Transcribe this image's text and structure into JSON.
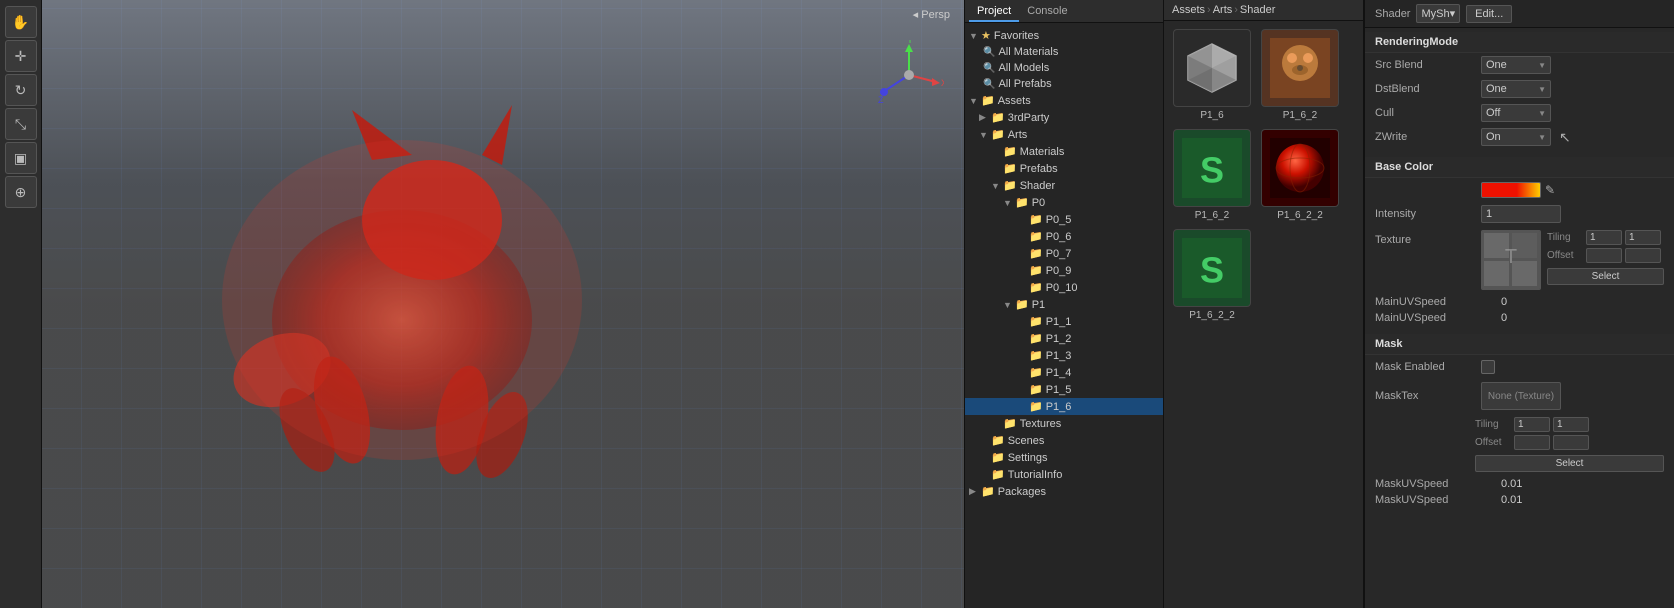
{
  "toolbar": {
    "buttons": [
      {
        "id": "hand",
        "icon": "✋",
        "active": false
      },
      {
        "id": "move",
        "icon": "✛",
        "active": false
      },
      {
        "id": "rotate",
        "icon": "↻",
        "active": false
      },
      {
        "id": "scale",
        "icon": "⤡",
        "active": false
      },
      {
        "id": "rect",
        "icon": "▣",
        "active": false
      },
      {
        "id": "gizmo",
        "icon": "⊕",
        "active": false
      }
    ]
  },
  "viewport": {
    "label": "◂ Persp"
  },
  "project": {
    "tabs": [
      "Project",
      "Console"
    ],
    "activeTab": "Project",
    "tree": [
      {
        "id": "favorites",
        "label": "Favorites",
        "indent": 0,
        "expanded": true,
        "type": "folder"
      },
      {
        "id": "all-materials",
        "label": "All Materials",
        "indent": 1,
        "type": "search"
      },
      {
        "id": "all-models",
        "label": "All Models",
        "indent": 1,
        "type": "search"
      },
      {
        "id": "all-prefabs",
        "label": "All Prefabs",
        "indent": 1,
        "type": "search"
      },
      {
        "id": "assets",
        "label": "Assets",
        "indent": 0,
        "expanded": true,
        "type": "folder"
      },
      {
        "id": "3rdparty",
        "label": "3rdParty",
        "indent": 1,
        "type": "folder"
      },
      {
        "id": "arts",
        "label": "Arts",
        "indent": 1,
        "expanded": true,
        "type": "folder"
      },
      {
        "id": "materials",
        "label": "Materials",
        "indent": 2,
        "type": "folder"
      },
      {
        "id": "prefabs",
        "label": "Prefabs",
        "indent": 2,
        "type": "folder"
      },
      {
        "id": "shader",
        "label": "Shader",
        "indent": 2,
        "expanded": true,
        "type": "folder"
      },
      {
        "id": "p0",
        "label": "P0",
        "indent": 3,
        "expanded": true,
        "type": "folder"
      },
      {
        "id": "p0_5",
        "label": "P0_5",
        "indent": 4,
        "type": "folder"
      },
      {
        "id": "p0_6",
        "label": "P0_6",
        "indent": 4,
        "type": "folder"
      },
      {
        "id": "p0_7",
        "label": "P0_7",
        "indent": 4,
        "type": "folder"
      },
      {
        "id": "p0_9",
        "label": "P0_9",
        "indent": 4,
        "type": "folder"
      },
      {
        "id": "p0_10",
        "label": "P0_10",
        "indent": 4,
        "type": "folder"
      },
      {
        "id": "p1",
        "label": "P1",
        "indent": 3,
        "expanded": true,
        "type": "folder"
      },
      {
        "id": "p1_1",
        "label": "P1_1",
        "indent": 4,
        "type": "folder"
      },
      {
        "id": "p1_2",
        "label": "P1_2",
        "indent": 4,
        "type": "folder"
      },
      {
        "id": "p1_3",
        "label": "P1_3",
        "indent": 4,
        "type": "folder"
      },
      {
        "id": "p1_4",
        "label": "P1_4",
        "indent": 4,
        "type": "folder"
      },
      {
        "id": "p1_5",
        "label": "P1_5",
        "indent": 4,
        "type": "folder"
      },
      {
        "id": "p1_6",
        "label": "P1_6",
        "indent": 4,
        "type": "folder",
        "selected": true
      },
      {
        "id": "textures",
        "label": "Textures",
        "indent": 2,
        "type": "folder"
      },
      {
        "id": "scenes",
        "label": "Scenes",
        "indent": 1,
        "type": "folder"
      },
      {
        "id": "settings",
        "label": "Settings",
        "indent": 1,
        "type": "folder"
      },
      {
        "id": "tutorialinfo",
        "label": "TutorialInfo",
        "indent": 1,
        "type": "folder"
      },
      {
        "id": "packages",
        "label": "Packages",
        "indent": 0,
        "type": "folder"
      }
    ]
  },
  "assets": {
    "breadcrumb": [
      "Assets",
      "Arts",
      "Shader"
    ],
    "items": [
      {
        "id": "p1_6_thumb1",
        "name": "P1_6",
        "type": "unity"
      },
      {
        "id": "p1_6_2_thumb",
        "name": "P1_6_2",
        "type": "texture_cat"
      },
      {
        "id": "p1_6_2_s",
        "name": "P1_6_2",
        "type": "shader_s"
      },
      {
        "id": "p1_6_2_2",
        "name": "P1_6_2_2",
        "type": "texture_red"
      },
      {
        "id": "p1_6_2_2s",
        "name": "P1_6_2_2",
        "type": "shader_s2"
      }
    ]
  },
  "inspector": {
    "shader_label": "Shader",
    "shader_name": "MySh▾",
    "edit_label": "Edit...",
    "sections": {
      "rendering_mode": {
        "title": "RenderingMode",
        "rows": [
          {
            "label": "Src Blend",
            "value": "One",
            "type": "dropdown"
          },
          {
            "label": "DstBlend",
            "value": "One",
            "type": "dropdown"
          },
          {
            "label": "Cull",
            "value": "Off",
            "type": "dropdown"
          },
          {
            "label": "ZWrite",
            "value": "On",
            "type": "dropdown"
          }
        ]
      },
      "base_color": {
        "title": "Base Color",
        "intensity_label": "Intensity",
        "intensity_value": "1",
        "texture_label": "Texture",
        "tiling_label": "Tiling",
        "tiling_x": "1",
        "tiling_y": "1",
        "offset_label": "Offset",
        "offset_x": "",
        "offset_y": "",
        "offset_select": "Select",
        "mainu_speed_label": "MainUVSpeed",
        "mainu_speed_value_1": "0",
        "mainu_speed_value_2": "0"
      },
      "mask": {
        "title": "Mask",
        "enabled_label": "Mask Enabled",
        "tex_label": "MaskTex",
        "tex_value": "None (Texture)",
        "tiling_label": "Tiling",
        "tiling_x": "1",
        "tiling_y": "1",
        "offset_label": "Offset",
        "offset_select": "Select",
        "maskuv_speed_label": "MaskUVSpeed",
        "maskuv_speed_val_1": "0.01",
        "maskuv_speed_val_2": "0.01"
      }
    }
  }
}
